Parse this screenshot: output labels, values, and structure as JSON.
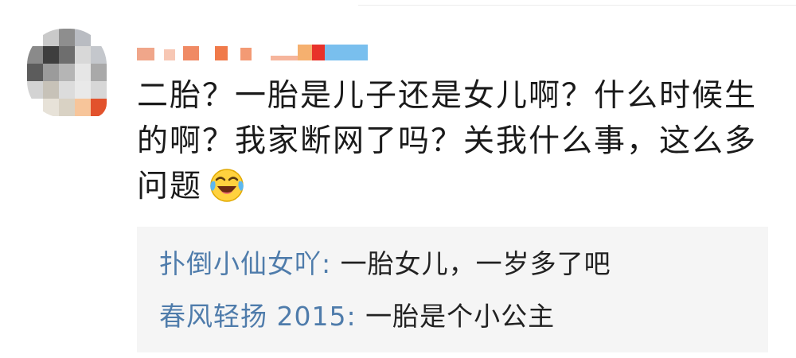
{
  "comment": {
    "text": "二胎？一胎是儿子还是女儿啊？什么时候生的啊？我家断网了吗？关我什么事，这么多问题",
    "emoji_icon": "laughing-crying-face-icon",
    "avatar_icon": "pixelated-avatar-icon",
    "username_icon": "pixelated-username-icon"
  },
  "replies": [
    {
      "user": "扑倒小仙女吖",
      "separator": ": ",
      "text": "一胎女儿，一岁多了吧"
    },
    {
      "user": "春风轻扬 2015",
      "separator": ": ",
      "text": "一胎是个小公主"
    }
  ],
  "colors": {
    "reply_username": "#4f7cab",
    "reply_background": "#f5f5f5",
    "comment_text": "#1a1a1a"
  }
}
